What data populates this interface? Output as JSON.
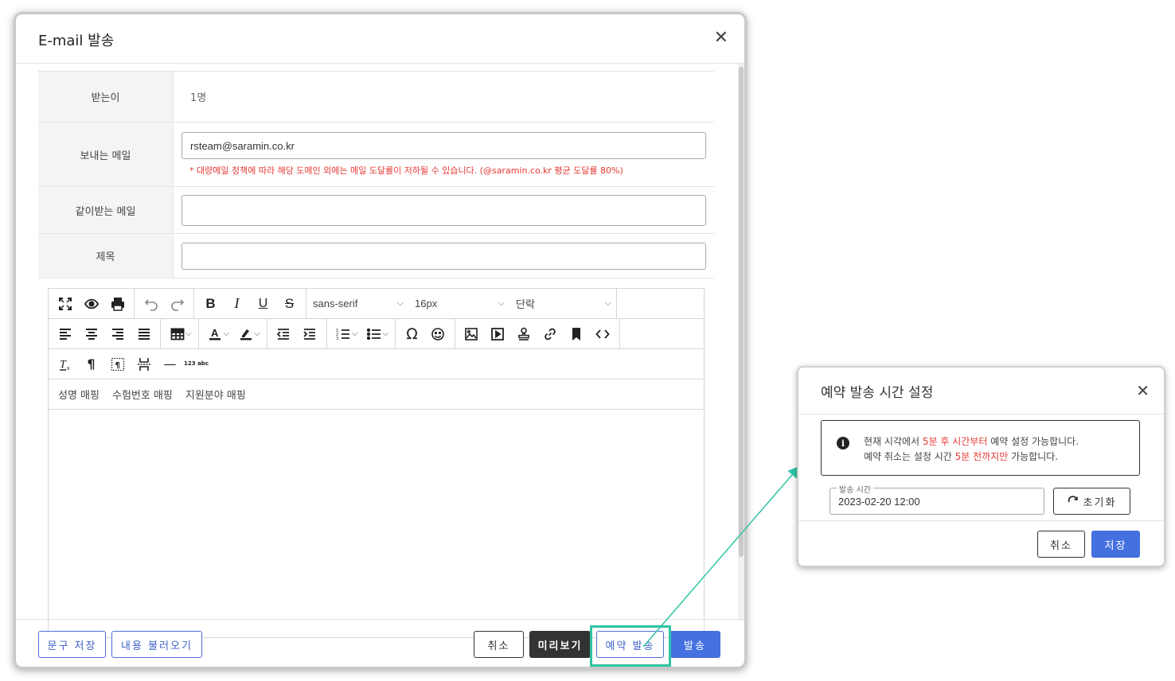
{
  "email_modal": {
    "title": "E-mail 발송",
    "close_icon": "✕",
    "rows": {
      "recipients": {
        "label": "받는이",
        "value": "1명"
      },
      "sender": {
        "label": "보내는 메일",
        "value": "rsteam@saramin.co.kr",
        "warning": "* 대량메일 정책에 따라 해당 도메인 외에는 메일 도달률이 저하될 수 있습니다. (@saramin.co.kr 평균 도달률 80%)"
      },
      "cc": {
        "label": "같이받는 메일",
        "value": ""
      },
      "subject": {
        "label": "제목",
        "value": ""
      }
    },
    "toolbar": {
      "font_family": "sans-serif",
      "font_size": "16px",
      "paragraph": "단락",
      "special_char": "Ω",
      "horizontal_rule": "—",
      "spell_check": "123 abc"
    },
    "mapping": [
      "성명 매핑",
      "수험번호 매핑",
      "지원분야 매핑"
    ],
    "footer": {
      "save_phrase": "문구 저장",
      "load_content": "내용 불러오기",
      "cancel": "취소",
      "preview": "미리보기",
      "schedule_send": "예약 발송",
      "send": "발송"
    }
  },
  "schedule_modal": {
    "title": "예약 발송 시간 설정",
    "close_icon": "✕",
    "notice": {
      "icon": "info-icon",
      "line1_pre": "현재 시각에서 ",
      "line1_red": "5분 후 시간부터",
      "line1_post": " 예약 설정 가능합니다.",
      "line2_pre": "예약 취소는 설정 시간 ",
      "line2_red": "5분 전까지만",
      "line2_post": " 가능합니다."
    },
    "time_field": {
      "legend": "발송 시간",
      "value": "2023-02-20 12:00"
    },
    "reset_button": "초기화",
    "cancel_button": "취소",
    "save_button": "저장"
  },
  "colors": {
    "accent_blue": "#4470e0",
    "warning_red": "#e53935",
    "highlight_teal": "#2ec4a5",
    "dark_button": "#333333"
  }
}
